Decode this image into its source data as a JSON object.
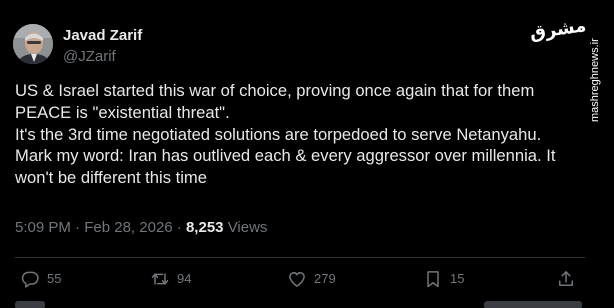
{
  "author": {
    "display_name": "Javad Zarif",
    "handle": "@JZarif"
  },
  "tweet": {
    "lines": [
      "US & Israel started this war of choice, proving once again that for them",
      "PEACE is \"existential threat\".",
      "It's the 3rd time negotiated solutions are torpedoed to serve Netanyahu.",
      "Mark my word: Iran has outlived each & every aggressor over millennia. It",
      "won't be different this time"
    ],
    "time": "5:09 PM",
    "separator": "·",
    "date": "Feb 28, 2026",
    "views_count": "8,253",
    "views_label": "Views"
  },
  "actions": {
    "reply": {
      "icon": "reply-icon",
      "count": "55"
    },
    "retweet": {
      "icon": "retweet-icon",
      "count": "94"
    },
    "like": {
      "icon": "heart-icon",
      "count": "279"
    },
    "bookmark": {
      "icon": "bookmark-icon",
      "count": "15"
    },
    "share": {
      "icon": "share-icon"
    }
  },
  "watermark": {
    "logo": "مشرق",
    "url": "mashreghnews.ir"
  },
  "colors": {
    "background": "#000000",
    "text_primary": "#e7e9ea",
    "text_secondary": "#71767b",
    "divider": "#2f3336"
  }
}
